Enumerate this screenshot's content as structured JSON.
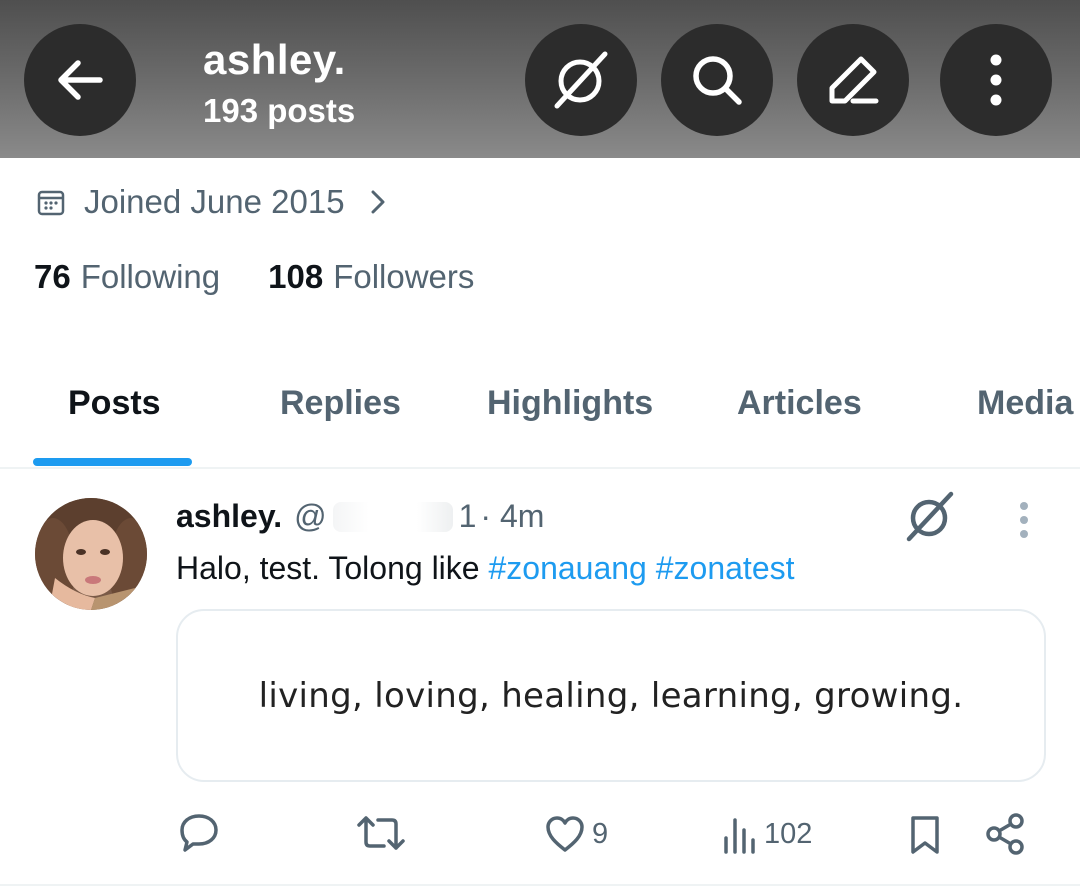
{
  "header": {
    "name": "ashley.",
    "post_count": "193 posts"
  },
  "profile": {
    "joined": "Joined June 2015",
    "following_count": "76",
    "following_label": "Following",
    "followers_count": "108",
    "followers_label": "Followers"
  },
  "tabs": [
    {
      "label": "Posts",
      "active": true
    },
    {
      "label": "Replies",
      "active": false
    },
    {
      "label": "Highlights",
      "active": false
    },
    {
      "label": "Articles",
      "active": false
    },
    {
      "label": "Media",
      "active": false
    }
  ],
  "post": {
    "author": "ashley.",
    "handle_prefix": "@",
    "handle_suffix": "1",
    "time": "· 4m",
    "text_plain": "Halo, test. Tolong like ",
    "hashtag_1": "#zonauang",
    "hashtag_2": "#zonatest",
    "card_text": "living, loving, healing, learning, growing.",
    "likes": "9",
    "views": "102"
  },
  "colors": {
    "accent": "#1d9bf0",
    "secondary_text": "#536471",
    "header_button": "#2c2c2c"
  },
  "icons": [
    "back-arrow-icon",
    "grok-icon",
    "search-icon",
    "pencil-icon",
    "more-vertical-icon",
    "calendar-icon",
    "chevron-right-icon",
    "reply-icon",
    "repost-icon",
    "heart-icon",
    "views-icon",
    "bookmark-icon",
    "share-icon"
  ]
}
